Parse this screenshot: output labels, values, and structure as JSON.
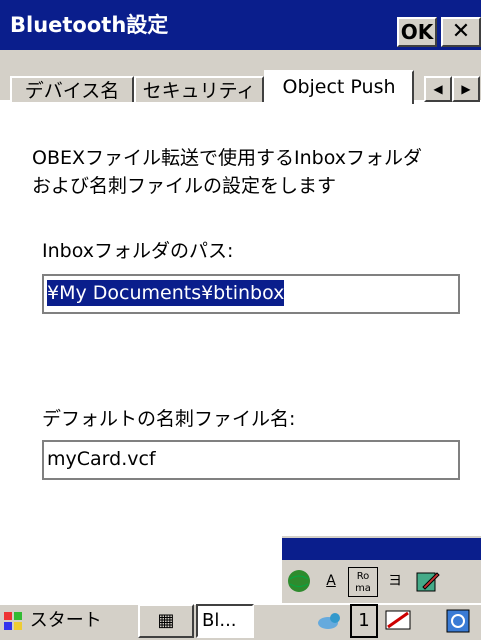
{
  "window": {
    "title": "Bluetooth設定",
    "ok_label": "OK",
    "close_label": "✕"
  },
  "tabs": [
    {
      "label": "デバイス名",
      "active": false
    },
    {
      "label": "セキュリティ",
      "active": false
    },
    {
      "label": "Object Push",
      "active": true
    }
  ],
  "tab_scroll": {
    "left": "◀",
    "right": "▶"
  },
  "content": {
    "description": "OBEXファイル転送で使用するInboxフォルダ\nおよび名刺ファイルの設定をします",
    "inbox_label": "Inboxフォルダのパス:",
    "inbox_value": "¥My Documents¥btinbox",
    "card_label": "デフォルトの名刺ファイル名:",
    "card_value": "myCard.vcf"
  },
  "sip": {
    "icons": [
      "globe-icon",
      "font-icon",
      "roma-icon",
      "kana-icon",
      "edit-icon"
    ],
    "font_label": "A",
    "roma_label": "Ro ma",
    "kana_label": "ヨ"
  },
  "taskbar": {
    "start_label": "スタート",
    "task_label": "Bl...",
    "tray_number": "1"
  },
  "colors": {
    "title_bg": "#0a1e8c",
    "chrome_bg": "#d4d0c8"
  }
}
